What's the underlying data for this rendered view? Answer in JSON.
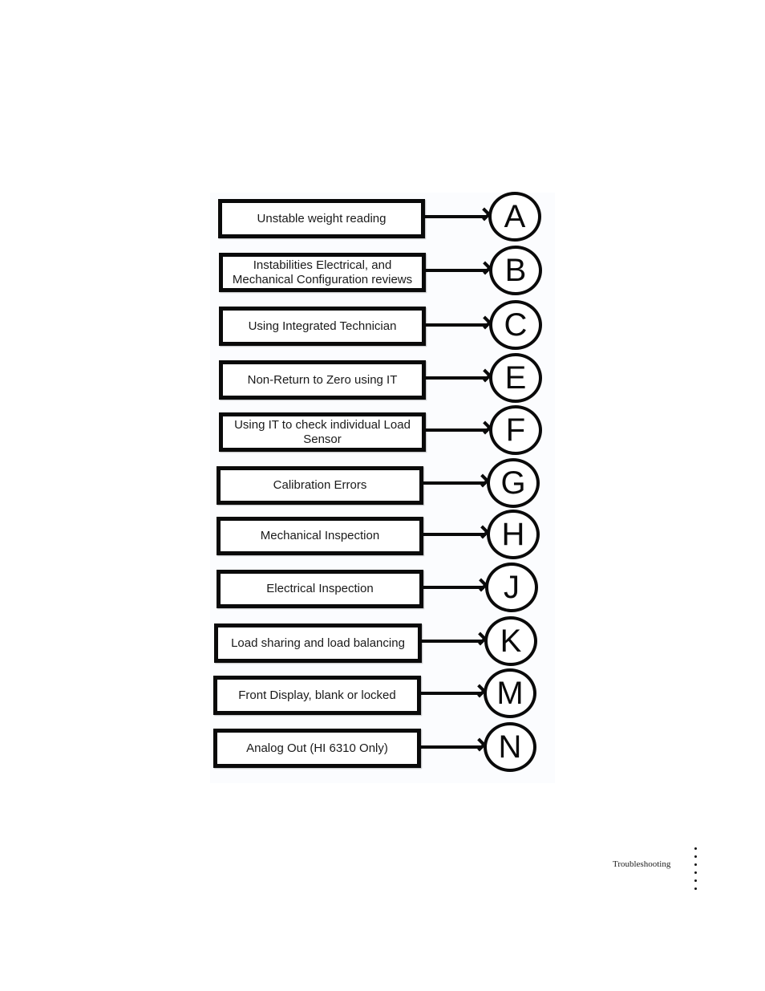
{
  "diagram": {
    "type": "troubleshooting-index",
    "items": [
      {
        "label": "Unstable weight reading",
        "letter": "A"
      },
      {
        "label": "Instabilities Electrical, and Mechanical Configuration reviews",
        "letter": "B"
      },
      {
        "label": "Using Integrated Technician",
        "letter": "C"
      },
      {
        "label": "Non-Return to Zero using IT",
        "letter": "E"
      },
      {
        "label": "Using IT to check individual Load Sensor",
        "letter": "F"
      },
      {
        "label": "Calibration Errors",
        "letter": "G"
      },
      {
        "label": "Mechanical Inspection",
        "letter": "H"
      },
      {
        "label": "Electrical Inspection",
        "letter": "J"
      },
      {
        "label": "Load sharing and load balancing",
        "letter": "K"
      },
      {
        "label": "Front Display, blank or locked",
        "letter": "M"
      },
      {
        "label": "Analog Out (HI 6310 Only)",
        "letter": "N"
      }
    ]
  },
  "footer": {
    "section_label": "Troubleshooting"
  }
}
